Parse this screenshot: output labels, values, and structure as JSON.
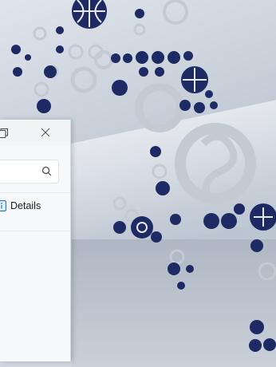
{
  "window": {
    "details_label": "Details",
    "accent": "#1a73c7"
  },
  "wallpaper": {
    "icon_color": "#1e2a63",
    "gear_color": "#c3c9d1"
  }
}
